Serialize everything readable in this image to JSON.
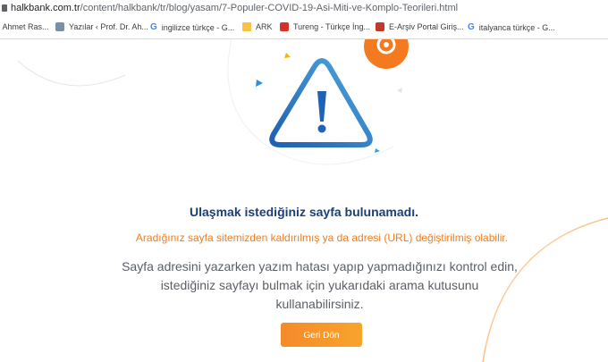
{
  "browser": {
    "url_host": "halkbank.com.tr",
    "url_path": "/content/halkbank/tr/blog/yasam/7-Populer-COVID-19-Asi-Miti-ve-Komplo-Teorileri.html"
  },
  "bookmarks": [
    {
      "label": ". Ahmet Ras...",
      "icon": "bookmark-icon"
    },
    {
      "label": "Yazılar ‹ Prof. Dr. Ah...",
      "icon": "avatar-icon"
    },
    {
      "label": "ingilizce türkçe - G...",
      "icon": "google-icon"
    },
    {
      "label": "ARK",
      "icon": "folder-icon"
    },
    {
      "label": "Tureng - Türkçe İng...",
      "icon": "tureng-icon"
    },
    {
      "label": "E-Arşiv Portal Giriş...",
      "icon": "portal-icon"
    },
    {
      "label": "italyanca türkçe - G...",
      "icon": "google-icon"
    }
  ],
  "error_page": {
    "heading": "Ulaşmak istediğiniz sayfa bulunamadı.",
    "subheading": "Aradığınız sayfa sitemizden kaldırılmış ya da adresi (URL) değiştirilmiş olabilir.",
    "body_line1": "Sayfa adresini yazarken yazım hatası yapıp yapmadığınızı kontrol edin,",
    "body_line2": "istediğiniz sayfayı bulmak için yukarıdaki arama kutusunu",
    "body_line3": "kullanabilirsiniz.",
    "button_label": "Geri Dön"
  },
  "colors": {
    "heading": "#1c3f77",
    "subheading": "#f07d1e",
    "button": "#f7962a",
    "warning_icon": "#1e73be"
  }
}
